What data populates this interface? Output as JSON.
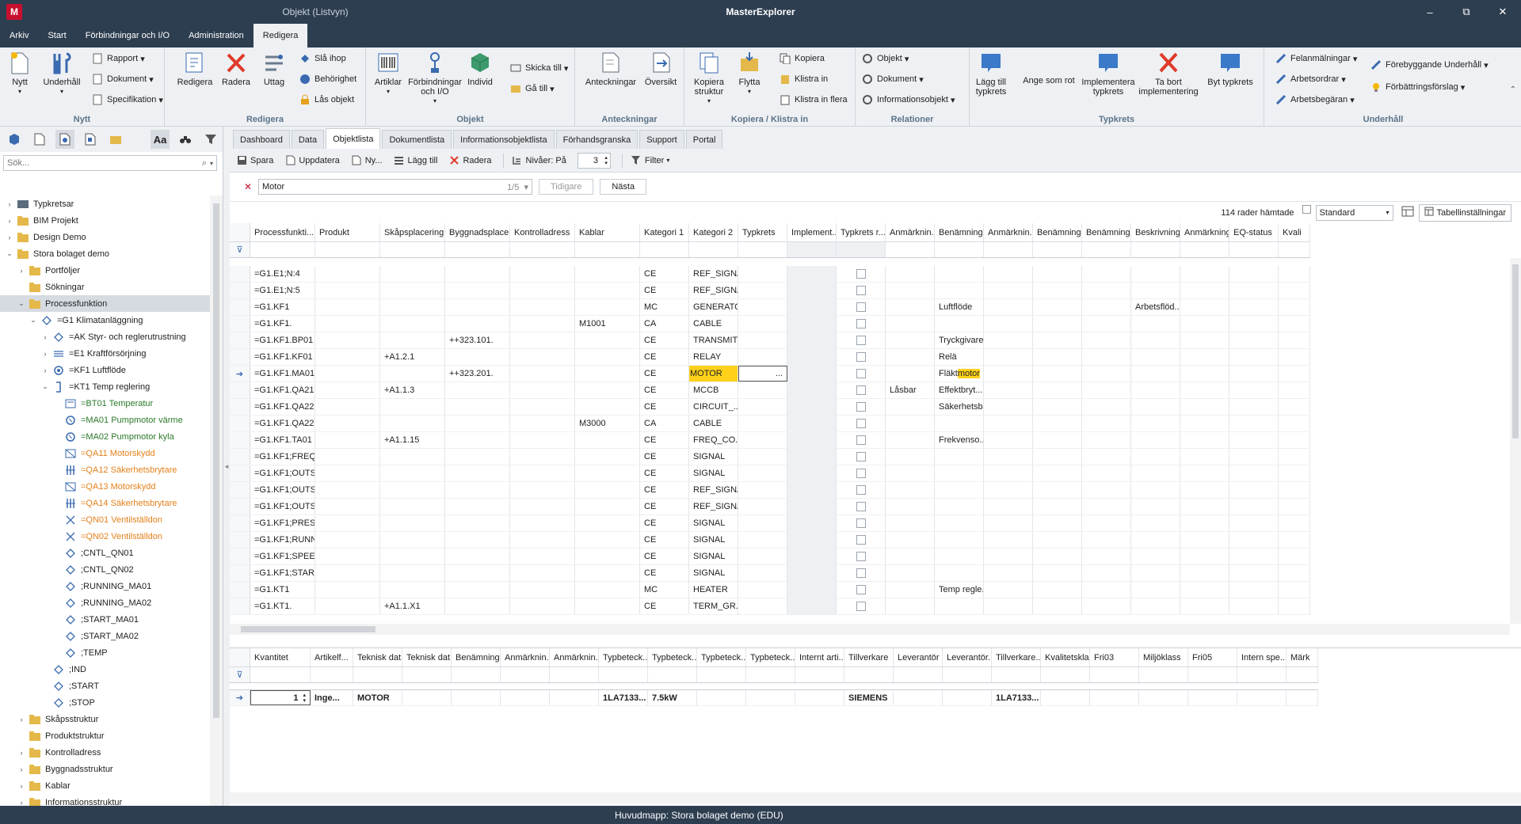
{
  "window": {
    "app_title": "MasterExplorer",
    "context_title": "Objekt (Listvyn)",
    "logo_text": "M",
    "buttons": {
      "minimize": "‒",
      "restore": "⧉",
      "close": "✕"
    }
  },
  "menu": {
    "tabs": [
      "Arkiv",
      "Start",
      "Förbindningar och I/O",
      "Administration",
      "Redigera"
    ],
    "active": "Redigera"
  },
  "ribbon": {
    "groups": {
      "nytt": {
        "label": "Nytt",
        "nytt": "Nytt",
        "underhall": "Underhåll",
        "rapport": "Rapport",
        "dokument": "Dokument",
        "specifikation": "Specifikation"
      },
      "redigera": {
        "label": "Redigera",
        "redigera": "Redigera",
        "radera": "Radera",
        "uttag": "Uttag",
        "sla_ihop": "Slå ihop",
        "behorighet": "Behörighet",
        "las_objekt": "Lås objekt"
      },
      "objekt": {
        "label": "Objekt",
        "artiklar": "Artiklar",
        "forbindningar_1": "Förbindningar",
        "forbindningar_2": "och I/O",
        "individ": "Individ",
        "skicka_till": "Skicka till",
        "ga_till": "Gå till"
      },
      "anteckningar": {
        "label": "Anteckningar",
        "anteckningar": "Anteckningar",
        "oversikt": "Översikt"
      },
      "kopiera": {
        "label": "Kopiera / Klistra in",
        "kopiera_struktur_1": "Kopiera",
        "kopiera_struktur_2": "struktur",
        "flytta": "Flytta",
        "kopiera": "Kopiera",
        "klistra_in": "Klistra in",
        "klistra_in_flera": "Klistra in flera"
      },
      "relationer": {
        "label": "Relationer",
        "objekt": "Objekt",
        "dokument": "Dokument",
        "informationsobjekt": "Informationsobjekt"
      },
      "typkrets": {
        "label": "Typkrets",
        "lagg_till_1": "Lägg till",
        "lagg_till_2": "typkrets",
        "ange_som_rot": "Ange som rot",
        "implementera_1": "Implementera",
        "implementera_2": "typkrets",
        "ta_bort_1": "Ta bort",
        "ta_bort_2": "implementering",
        "byt_typkrets": "Byt typkrets"
      },
      "underhall": {
        "label": "Underhåll",
        "felanmalningar": "Felanmälningar",
        "arbetsordrar": "Arbetsordrar",
        "arbetsbegaran": "Arbetsbegäran",
        "forebyggande": "Förebyggande Underhåll",
        "forbattringsforslag": "Förbättringsförslag"
      }
    }
  },
  "left_panel": {
    "tools": [
      "Aa"
    ],
    "search": {
      "placeholder": "Sök...",
      "value": ""
    },
    "tree": [
      {
        "label": "Typkretsar",
        "level": 0,
        "toggle": "›",
        "icon": "typkrets-icon",
        "color": "normal"
      },
      {
        "label": "BIM Projekt",
        "level": 0,
        "toggle": "›",
        "icon": "folder-icon",
        "color": "normal"
      },
      {
        "label": "Design Demo",
        "level": 0,
        "toggle": "›",
        "icon": "folder-icon",
        "color": "normal"
      },
      {
        "label": "Stora bolaget demo",
        "level": 0,
        "toggle": "⌄",
        "icon": "folder-icon",
        "color": "normal"
      },
      {
        "label": "Portföljer",
        "level": 1,
        "toggle": "›",
        "icon": "folder-icon",
        "color": "normal"
      },
      {
        "label": "Sökningar",
        "level": 1,
        "toggle": "",
        "icon": "folder-icon",
        "color": "normal"
      },
      {
        "label": "Processfunktion",
        "level": 1,
        "toggle": "⌄",
        "icon": "folder-icon",
        "color": "normal",
        "selected": true
      },
      {
        "label": "=G1   Klimatanläggning",
        "level": 2,
        "toggle": "⌄",
        "icon": "diamond-icon",
        "color": "normal"
      },
      {
        "label": "=AK   Styr- och reglerutrustning",
        "level": 3,
        "toggle": "›",
        "icon": "diamond-icon",
        "color": "normal"
      },
      {
        "label": "=E1   Kraftförsörjning",
        "level": 3,
        "toggle": "›",
        "icon": "power-icon",
        "color": "normal"
      },
      {
        "label": "=KF1   Luftflöde",
        "level": 3,
        "toggle": "›",
        "icon": "fan-icon",
        "color": "normal"
      },
      {
        "label": "=KT1   Temp reglering",
        "level": 3,
        "toggle": "⌄",
        "icon": "bracket-icon",
        "color": "normal"
      },
      {
        "label": "=BT01   Temperatur",
        "level": 4,
        "toggle": "",
        "icon": "sensor-icon",
        "color": "green"
      },
      {
        "label": "=MA01   Pumpmotor värme",
        "level": 4,
        "toggle": "",
        "icon": "motor-icon",
        "color": "green"
      },
      {
        "label": "=MA02   Pumpmotor kyla",
        "level": 4,
        "toggle": "",
        "icon": "motor-icon",
        "color": "green"
      },
      {
        "label": "=QA11   Motorskydd",
        "level": 4,
        "toggle": "",
        "icon": "breaker-icon",
        "color": "orange"
      },
      {
        "label": "=QA12   Säkerhetsbrytare",
        "level": 4,
        "toggle": "",
        "icon": "switch-icon",
        "color": "orange"
      },
      {
        "label": "=QA13   Motorskydd",
        "level": 4,
        "toggle": "",
        "icon": "breaker-icon",
        "color": "orange"
      },
      {
        "label": "=QA14   Säkerhetsbrytare",
        "level": 4,
        "toggle": "",
        "icon": "switch-icon",
        "color": "orange"
      },
      {
        "label": "=QN01   Ventilställdon",
        "level": 4,
        "toggle": "",
        "icon": "valve-icon",
        "color": "orange"
      },
      {
        "label": "=QN02   Ventilställdon",
        "level": 4,
        "toggle": "",
        "icon": "valve-icon",
        "color": "orange"
      },
      {
        "label": ";CNTL_QN01",
        "level": 4,
        "toggle": "",
        "icon": "diamond-icon",
        "color": "normal"
      },
      {
        "label": ";CNTL_QN02",
        "level": 4,
        "toggle": "",
        "icon": "diamond-icon",
        "color": "normal"
      },
      {
        "label": ";RUNNING_MA01",
        "level": 4,
        "toggle": "",
        "icon": "diamond-icon",
        "color": "normal"
      },
      {
        "label": ";RUNNING_MA02",
        "level": 4,
        "toggle": "",
        "icon": "diamond-icon",
        "color": "normal"
      },
      {
        "label": ";START_MA01",
        "level": 4,
        "toggle": "",
        "icon": "diamond-icon",
        "color": "normal"
      },
      {
        "label": ";START_MA02",
        "level": 4,
        "toggle": "",
        "icon": "diamond-icon",
        "color": "normal"
      },
      {
        "label": ";TEMP",
        "level": 4,
        "toggle": "",
        "icon": "diamond-icon",
        "color": "normal"
      },
      {
        "label": ";IND",
        "level": 3,
        "toggle": "",
        "icon": "diamond-icon",
        "color": "normal"
      },
      {
        "label": ";START",
        "level": 3,
        "toggle": "",
        "icon": "diamond-icon",
        "color": "normal"
      },
      {
        "label": ";STOP",
        "level": 3,
        "toggle": "",
        "icon": "diamond-icon",
        "color": "normal"
      },
      {
        "label": "Skåpsstruktur",
        "level": 1,
        "toggle": "›",
        "icon": "folder-icon",
        "color": "normal"
      },
      {
        "label": "Produktstruktur",
        "level": 1,
        "toggle": "",
        "icon": "folder-icon",
        "color": "normal"
      },
      {
        "label": "Kontrolladress",
        "level": 1,
        "toggle": "›",
        "icon": "folder-icon",
        "color": "normal"
      },
      {
        "label": "Byggnadsstruktur",
        "level": 1,
        "toggle": "›",
        "icon": "folder-icon",
        "color": "normal"
      },
      {
        "label": "Kablar",
        "level": 1,
        "toggle": "›",
        "icon": "folder-icon",
        "color": "normal"
      },
      {
        "label": "Informationsstruktur",
        "level": 1,
        "toggle": "›",
        "icon": "folder-icon",
        "color": "normal"
      }
    ]
  },
  "doc_tabs": {
    "tabs": [
      "Dashboard",
      "Data",
      "Objektlista",
      "Dokumentlista",
      "Informationsobjektlista",
      "Förhandsgranska",
      "Support",
      "Portal"
    ],
    "active": "Objektlista"
  },
  "toolbar": {
    "spara": "Spara",
    "uppdatera": "Uppdatera",
    "ny": "Ny...",
    "lagg_till": "Lägg till",
    "radera": "Radera",
    "nivaer": "Nivåer: På",
    "level_value": "3",
    "filter": "Filter"
  },
  "find": {
    "value": "Motor",
    "count": "1/5",
    "prev": "Tidigare",
    "next": "Nästa"
  },
  "options": {
    "rows_fetched": "114 rader hämtade",
    "view": "Standard",
    "table_settings": "Tabellinställningar"
  },
  "main_grid": {
    "columns": [
      "Processfunkti...",
      "Produkt",
      "Skåpsplacering",
      "Byggnadsplaceri...",
      "Kontrolladress",
      "Kablar",
      "Kategori 1",
      "Kategori 2",
      "Typkrets",
      "Implement...",
      "Typkrets r...",
      "Anmärknin...",
      "Benämning",
      "Anmärknin...",
      "Benämning 2",
      "Benämning 3",
      "Beskrivning",
      "Anmärkning",
      "EQ-status",
      "Kvali"
    ],
    "rows": [
      [
        "=G1.E1;N:4",
        "",
        "",
        "",
        "",
        "",
        "CE",
        "REF_SIGNAL",
        "",
        "",
        "",
        "",
        "",
        "",
        "",
        "",
        "",
        "",
        "",
        ""
      ],
      [
        "=G1.E1;N:5",
        "",
        "",
        "",
        "",
        "",
        "CE",
        "REF_SIGNAL",
        "",
        "",
        "",
        "",
        "",
        "",
        "",
        "",
        "",
        "",
        "",
        ""
      ],
      [
        "=G1.KF1",
        "",
        "",
        "",
        "",
        "",
        "MC",
        "GENERATOR",
        "",
        "",
        "",
        "",
        "Luftflöde",
        "",
        "",
        "",
        "Arbetsflöd...",
        "",
        "",
        ""
      ],
      [
        "=G1.KF1.",
        "",
        "",
        "",
        "",
        "M1001",
        "CA",
        "CABLE",
        "",
        "",
        "",
        "",
        "",
        "",
        "",
        "",
        "",
        "",
        "",
        ""
      ],
      [
        "=G1.KF1.BP01",
        "",
        "",
        "++323.101.",
        "",
        "",
        "CE",
        "TRANSMIT...",
        "",
        "",
        "",
        "",
        "Tryckgivare",
        "",
        "",
        "",
        "",
        "",
        "",
        ""
      ],
      [
        "=G1.KF1.KF01",
        "",
        "+A1.2.1",
        "",
        "",
        "",
        "CE",
        "RELAY",
        "",
        "",
        "",
        "",
        "Relä",
        "",
        "",
        "",
        "",
        "",
        "",
        ""
      ],
      [
        "=G1.KF1.MA01",
        "",
        "",
        "++323.201.",
        "",
        "",
        "CE",
        "MOTOR",
        "",
        "",
        "",
        "",
        "Fläktmotor",
        "",
        "",
        "",
        "",
        "",
        "",
        ""
      ],
      [
        "=G1.KF1.QA21",
        "",
        "+A1.1.3",
        "",
        "",
        "",
        "CE",
        "MCCB",
        "",
        "",
        "",
        "Låsbar",
        "Effektbryt...",
        "",
        "",
        "",
        "",
        "",
        "",
        ""
      ],
      [
        "=G1.KF1.QA22",
        "",
        "",
        "",
        "",
        "",
        "CE",
        "CIRCUIT_...",
        "",
        "",
        "",
        "",
        "Säkerhetsb...",
        "",
        "",
        "",
        "",
        "",
        "",
        ""
      ],
      [
        "=G1.KF1.QA22.",
        "",
        "",
        "",
        "",
        "M3000",
        "CA",
        "CABLE",
        "",
        "",
        "",
        "",
        "",
        "",
        "",
        "",
        "",
        "",
        "",
        ""
      ],
      [
        "=G1.KF1.TA01",
        "",
        "+A1.1.15",
        "",
        "",
        "",
        "CE",
        "FREQ_CO...",
        "",
        "",
        "",
        "",
        "Frekvenso...",
        "",
        "",
        "",
        "",
        "",
        "",
        ""
      ],
      [
        "=G1.KF1;FREQ...",
        "",
        "",
        "",
        "",
        "",
        "CE",
        "SIGNAL",
        "",
        "",
        "",
        "",
        "",
        "",
        "",
        "",
        "",
        "",
        "",
        ""
      ],
      [
        "=G1.KF1;OUTS...",
        "",
        "",
        "",
        "",
        "",
        "CE",
        "SIGNAL",
        "",
        "",
        "",
        "",
        "",
        "",
        "",
        "",
        "",
        "",
        "",
        ""
      ],
      [
        "=G1.KF1;OUTS...",
        "",
        "",
        "",
        "",
        "",
        "CE",
        "REF_SIGNAL",
        "",
        "",
        "",
        "",
        "",
        "",
        "",
        "",
        "",
        "",
        "",
        ""
      ],
      [
        "=G1.KF1;OUTS...",
        "",
        "",
        "",
        "",
        "",
        "CE",
        "REF_SIGNAL",
        "",
        "",
        "",
        "",
        "",
        "",
        "",
        "",
        "",
        "",
        "",
        ""
      ],
      [
        "=G1.KF1;PRESS...",
        "",
        "",
        "",
        "",
        "",
        "CE",
        "SIGNAL",
        "",
        "",
        "",
        "",
        "",
        "",
        "",
        "",
        "",
        "",
        "",
        ""
      ],
      [
        "=G1.KF1;RUNNI...",
        "",
        "",
        "",
        "",
        "",
        "CE",
        "SIGNAL",
        "",
        "",
        "",
        "",
        "",
        "",
        "",
        "",
        "",
        "",
        "",
        ""
      ],
      [
        "=G1.KF1;SPEED...",
        "",
        "",
        "",
        "",
        "",
        "CE",
        "SIGNAL",
        "",
        "",
        "",
        "",
        "",
        "",
        "",
        "",
        "",
        "",
        "",
        ""
      ],
      [
        "=G1.KF1;START...",
        "",
        "",
        "",
        "",
        "",
        "CE",
        "SIGNAL",
        "",
        "",
        "",
        "",
        "",
        "",
        "",
        "",
        "",
        "",
        "",
        ""
      ],
      [
        "=G1.KT1",
        "",
        "",
        "",
        "",
        "",
        "MC",
        "HEATER",
        "",
        "",
        "",
        "",
        "Temp regle...",
        "",
        "",
        "",
        "",
        "",
        "",
        ""
      ],
      [
        "=G1.KT1.",
        "",
        "+A1.1.X1",
        "",
        "",
        "",
        "CE",
        "TERM_GR...",
        "",
        "",
        "",
        "",
        "",
        "",
        "",
        "",
        "",
        "",
        "",
        ""
      ]
    ],
    "current_row": 6,
    "highlight_col": 7,
    "highlight_text": {
      "prefix": "Fläkt",
      "match": "motor"
    },
    "current_marker": "➔",
    "cell_button": "..."
  },
  "detail_grid": {
    "columns": [
      "Kvantitet",
      "Artikelf...",
      "Teknisk dat...",
      "Teknisk dat...",
      "Benämning",
      "Anmärknin...",
      "Anmärknin...",
      "Typbeteck...",
      "Typbeteck...",
      "Typbeteck...",
      "Typbeteck...",
      "Internt arti...",
      "Tillverkare",
      "Leverantör",
      "Leverantör...",
      "Tillverkare...",
      "Kvalitetskla...",
      "Fri03",
      "Miljöklass",
      "Fri05",
      "Intern spe...",
      "Märk"
    ],
    "row": [
      "1",
      "Inge...",
      "MOTOR",
      "",
      "",
      "",
      "",
      "1LA7133...",
      "7.5kW",
      "",
      "",
      "",
      "SIEMENS",
      "",
      "",
      "1LA7133...",
      "",
      "",
      "",
      "",
      "",
      ""
    ],
    "marker": "➔"
  },
  "statusbar": {
    "text": "Huvudmapp: Stora bolaget demo (EDU)"
  },
  "colors": {
    "titlebar": "#2d3e50",
    "ribbon": "#eef0f3",
    "highlight": "#ffd11a",
    "green": "#2a7a2a",
    "orange": "#e5801a",
    "accent": "#3a6ab0"
  }
}
